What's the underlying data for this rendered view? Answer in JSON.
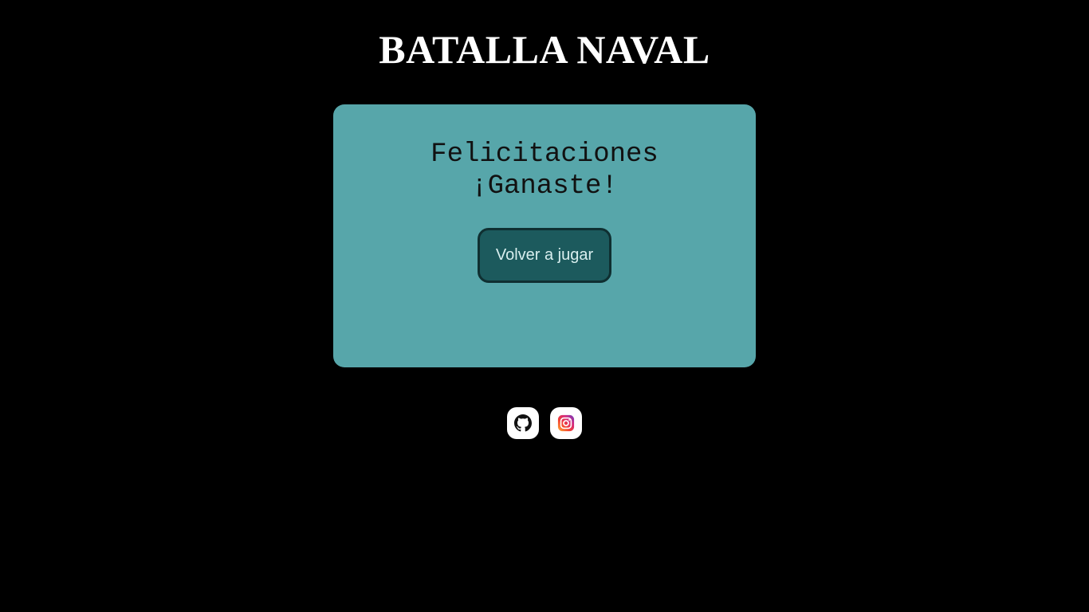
{
  "header": {
    "title": "BATALLA NAVAL"
  },
  "result": {
    "line1": "Felicitaciones",
    "line2": "¡Ganaste!",
    "replay_label": "Volver a jugar"
  },
  "social": [
    {
      "icon": "github-icon",
      "label": "GitHub"
    },
    {
      "icon": "instagram-icon",
      "label": "Instagram"
    }
  ],
  "colors": {
    "background": "#000000",
    "card": "#57a6aa",
    "button": "#1c5a5d",
    "button_border": "#0f2f31",
    "title": "#ffffff"
  }
}
